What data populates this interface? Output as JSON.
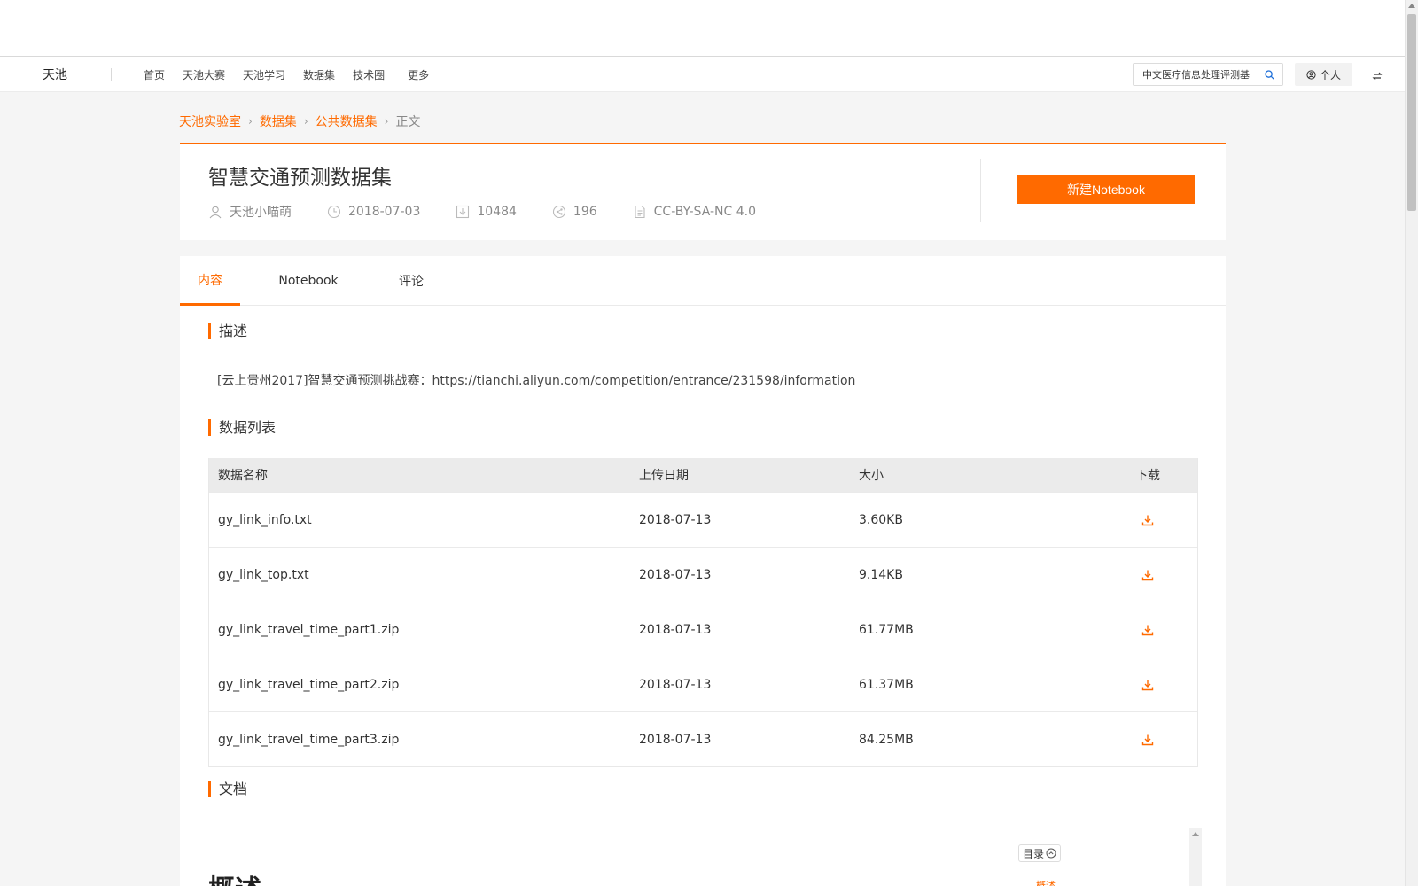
{
  "nav": {
    "brand": "天池",
    "links": [
      "首页",
      "天池大赛",
      "天池学习",
      "数据集",
      "技术圈"
    ],
    "more": "更多",
    "search_value": "中文医疗信息处理评测基",
    "user_label": "个人"
  },
  "breadcrumb": {
    "items": [
      "天池实验室",
      "数据集",
      "公共数据集"
    ],
    "current": "正文"
  },
  "dataset": {
    "title": "智慧交通预测数据集",
    "author": "天池小喵萌",
    "date": "2018-07-03",
    "downloads": "10484",
    "shares": "196",
    "license": "CC-BY-SA-NC 4.0",
    "new_notebook_label": "新建Notebook"
  },
  "tabs": [
    "内容",
    "Notebook",
    "评论"
  ],
  "sections": {
    "description_title": "描述",
    "description_text": "[云上贵州2017]智慧交通预测挑战赛：https://tianchi.aliyun.com/competition/entrance/231598/information",
    "data_list_title": "数据列表",
    "docs_title": "文档"
  },
  "table": {
    "headers": [
      "数据名称",
      "上传日期",
      "大小",
      "下载"
    ],
    "rows": [
      {
        "name": "gy_link_info.txt",
        "date": "2018-07-13",
        "size": "3.60KB"
      },
      {
        "name": "gy_link_top.txt",
        "date": "2018-07-13",
        "size": "9.14KB"
      },
      {
        "name": "gy_link_travel_time_part1.zip",
        "date": "2018-07-13",
        "size": "61.77MB"
      },
      {
        "name": "gy_link_travel_time_part2.zip",
        "date": "2018-07-13",
        "size": "61.37MB"
      },
      {
        "name": "gy_link_travel_time_part3.zip",
        "date": "2018-07-13",
        "size": "84.25MB"
      }
    ]
  },
  "doc": {
    "toc_label": "目录",
    "toc_first_item": "概述",
    "heading": "概述"
  },
  "colors": {
    "accent": "#ff6a00"
  }
}
